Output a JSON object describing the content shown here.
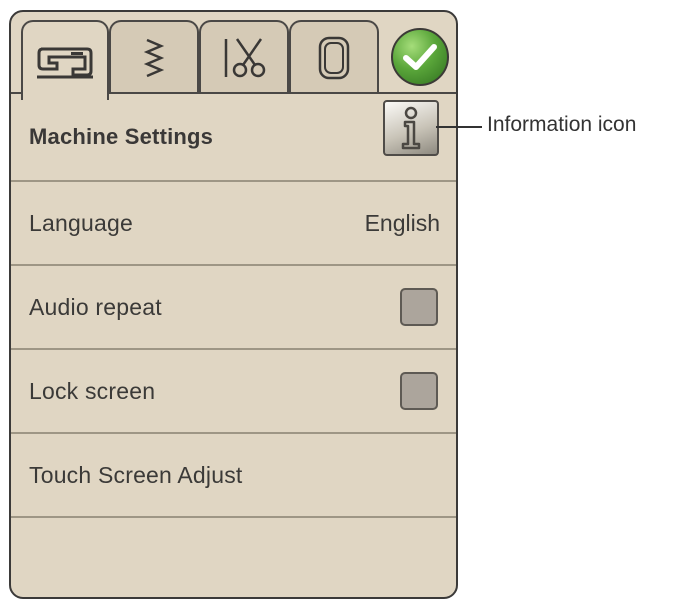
{
  "tabs": [
    {
      "icon": "sewing-machine-icon"
    },
    {
      "icon": "zigzag-stitch-icon"
    },
    {
      "icon": "needle-scissors-icon"
    },
    {
      "icon": "hoop-icon"
    }
  ],
  "ok_button": {
    "icon": "checkmark-icon"
  },
  "header": {
    "title": "Machine Settings",
    "info_icon": "info-icon"
  },
  "settings": {
    "language": {
      "label": "Language",
      "value": "English"
    },
    "audio_repeat": {
      "label": "Audio repeat",
      "checked": false
    },
    "lock_screen": {
      "label": "Lock screen",
      "checked": false
    },
    "touch_screen_adjust": {
      "label": "Touch Screen Adjust"
    }
  },
  "callout": {
    "text": "Information icon"
  }
}
